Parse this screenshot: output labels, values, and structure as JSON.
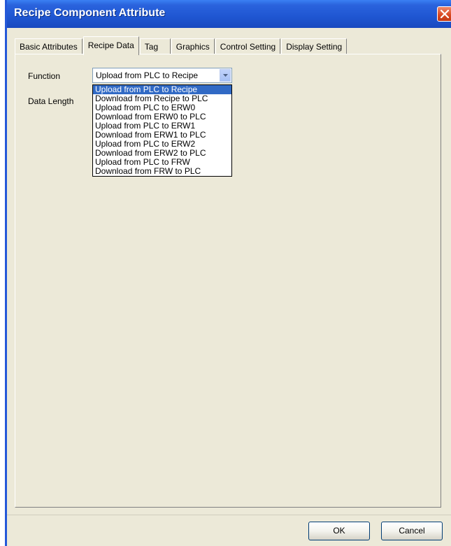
{
  "window": {
    "title": "Recipe Component Attribute"
  },
  "tabs": [
    {
      "label": "Basic Attributes"
    },
    {
      "label": "Recipe Data"
    },
    {
      "label": "Tag"
    },
    {
      "label": "Graphics"
    },
    {
      "label": "Control Setting"
    },
    {
      "label": "Display Setting"
    }
  ],
  "active_tab": "Recipe Data",
  "form": {
    "function_label": "Function",
    "data_length_label": "Data Length",
    "function_value": "Upload from PLC to Recipe"
  },
  "dropdown_options": [
    "Upload from PLC to Recipe",
    "Download from Recipe to PLC",
    "Upload from PLC to ERW0",
    "Download from ERW0 to PLC",
    "Upload from PLC to ERW1",
    "Download from ERW1 to PLC",
    "Upload from PLC to ERW2",
    "Download from ERW2 to PLC",
    "Upload from PLC to FRW",
    "Download from FRW to PLC"
  ],
  "selected_option_index": 0,
  "buttons": {
    "ok": "OK",
    "cancel": "Cancel"
  },
  "colors": {
    "titlebar": "#2a63dd",
    "selection": "#316ac5",
    "dialog_bg": "#ece9d8"
  },
  "icons": {
    "close": "close-icon",
    "dropdown": "chevron-down-icon"
  }
}
